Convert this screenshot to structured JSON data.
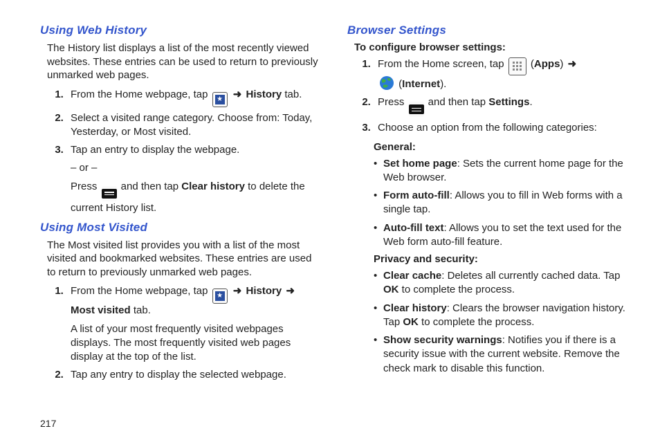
{
  "page_number": "217",
  "left": {
    "section1": {
      "title": "Using Web History",
      "intro": "The History list displays a list of the most recently viewed websites. These entries can be used to return to previously unmarked web pages.",
      "s1_pre": "From the Home webpage, tap ",
      "s1_arrow": "➜",
      "s1_history": "History",
      "s1_post": " tab.",
      "s2": "Select a visited range category. Choose from: Today, Yesterday, or Most visited.",
      "s3": "Tap an entry to display the webpage.",
      "s3_or": "– or –",
      "s3_press": "Press ",
      "s3_mid": " and then tap ",
      "s3_clear": "Clear history",
      "s3_end": " to delete the current History list."
    },
    "section2": {
      "title": "Using Most Visited",
      "intro": "The Most visited list provides you with a list of the most visited and bookmarked websites. These entries are used to return to previously unmarked web pages.",
      "s1_pre": "From the Home webpage, tap ",
      "s1_arrow1": "➜",
      "s1_hist": "History",
      "s1_arrow2": "➜",
      "s1_mv": "Most visited",
      "s1_post": " tab.",
      "s1_sub": "A list of your most frequently visited webpages displays. The most frequently visited web pages display at the top of the list.",
      "s2": "Tap any entry to display the selected webpage."
    }
  },
  "right": {
    "section": {
      "title": "Browser Settings",
      "lead": "To configure browser settings:",
      "s1_pre": "From the Home screen, tap ",
      "s1_paren_open": " (",
      "s1_apps": "Apps",
      "s1_paren_close": ") ",
      "s1_arrow": "➜",
      "s1_paren_open2": " (",
      "s1_internet": "Internet",
      "s1_paren_close2": ").",
      "s2_pre": "Press ",
      "s2_mid": " and then tap ",
      "s2_settings": "Settings",
      "s2_end": ".",
      "s3": "Choose an option from the following categories:",
      "general_head": "General:",
      "gen1_b": "Set home page",
      "gen1_t": ": Sets the current home page for the Web browser.",
      "gen2_b": "Form auto-fill",
      "gen2_t": ": Allows you to fill in Web forms with a single tap.",
      "gen3_b": "Auto-fill text",
      "gen3_t": ": Allows you to set the text used for the Web form auto-fill feature.",
      "privacy_head": "Privacy and security:",
      "pr1_b": "Clear cache",
      "pr1_t1": ": Deletes all currently cached data. Tap ",
      "pr1_ok": "OK",
      "pr1_t2": " to complete the process.",
      "pr2_b": "Clear history",
      "pr2_t1": ": Clears the browser navigation history. Tap ",
      "pr2_ok": "OK",
      "pr2_t2": " to complete the process.",
      "pr3_b": "Show security warnings",
      "pr3_t": ": Notifies you if there is a security issue with the current website. Remove the check mark to disable this function."
    }
  }
}
